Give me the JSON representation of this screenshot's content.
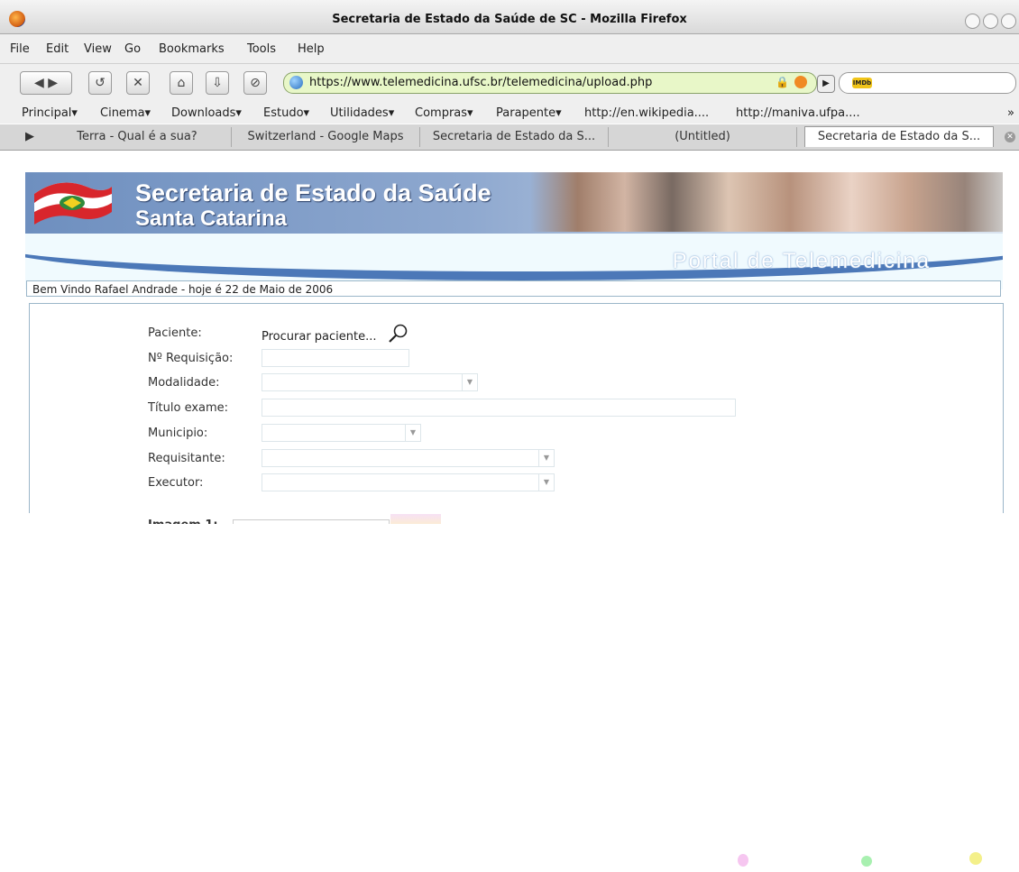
{
  "window": {
    "title": "Secretaria de Estado da Saúde de SC - Mozilla Firefox"
  },
  "menu": {
    "items": [
      "File",
      "Edit",
      "View",
      "Go",
      "Bookmarks",
      "Tools",
      "Help"
    ]
  },
  "navigation": {
    "url": "https://www.telemedicina.ufsc.br/telemedicina/upload.php",
    "search_engine": "IMDb",
    "buttons": {
      "back": "◀",
      "forward": "▶",
      "reload": "↺",
      "stop": "✕",
      "home": "⌂",
      "download": "⇩",
      "history": "⊘"
    }
  },
  "bookmarks": {
    "items": [
      "Principal▾",
      "Cinema▾",
      "Downloads▾",
      "Estudo▾",
      "Utilidades▾",
      "Compras▾",
      "Parapente▾",
      "http://en.wikipedia....",
      "http://maniva.ufpa....",
      "»"
    ]
  },
  "tabs": {
    "items": [
      "Terra - Qual é a sua?",
      "Switzerland - Google Maps",
      "Secretaria de Estado da S...",
      "(Untitled)",
      "Secretaria de Estado da S..."
    ],
    "active_index": 4
  },
  "banner": {
    "title_line1": "Secretaria de Estado da Saúde",
    "title_line2": "Santa Catarina",
    "portal": "Portal de Telemedicina"
  },
  "welcome": "Bem Vindo Rafael Andrade - hoje é 22 de Maio de 2006",
  "form": {
    "paciente_label": "Paciente:",
    "procurar_text": "Procurar paciente...",
    "requisicao_label": "Nº Requisição:",
    "modalidade_label": "Modalidade:",
    "titulo_label": "Título exame:",
    "municipio_label": "Municipio:",
    "requisitante_label": "Requisitante:",
    "executor_label": "Executor:",
    "imagem_label": "Imagem 1:"
  },
  "colors": {
    "banner_blue": "#6e8fbf",
    "wave_blue": "#4c78b8",
    "urlbar_green": "#e8f7c8",
    "border_blue": "#9bb6c9"
  }
}
